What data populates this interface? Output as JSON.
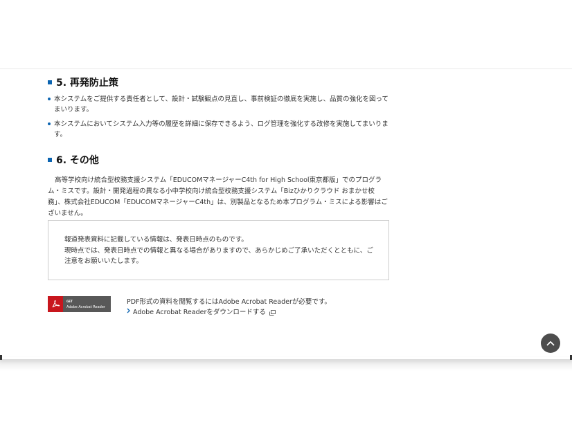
{
  "section5": {
    "heading": "5. 再発防止策",
    "bullets": [
      "本システムをご提供する責任者として、設計・試験観点の見直し、事前検証の徹底を実施し、品質の強化を図ってまいります。",
      "本システムにおいてシステム入力等の履歴を詳細に保存できるよう、ログ管理を強化する改修を実施してまいります。"
    ]
  },
  "section6": {
    "heading": "6. その他",
    "paragraph": "高等学校向け統合型校務支援システム「EDUCOMマネージャーC4th for High School東京都版」でのプログラム・ミスです。設計・開発過程の異なる小中学校向け統合型校務支援システム「Bizひかりクラウド おまかせ校務」、株式会社EDUCOM「EDUCOMマネージャーC4th」は、別製品となるため本プログラム・ミスによる影響はございません。"
  },
  "notice": {
    "line1": "報道発表資料に記載している情報は、発表日時点のものです。",
    "line2": "現時点では、発表日時点での情報と異なる場合がありますので、あらかじめご了承いただくとともに、ご注意をお願いいたします。"
  },
  "acrobat": {
    "badge_get": "GET",
    "badge_name": "Adobe Acrobat Reader",
    "info_text": "PDF形式の資料を閲覧するにはAdobe Acrobat Readerが必要です。",
    "download_link": "Adobe Acrobat Readerをダウンロードする"
  },
  "icons": {
    "bullet": "bullet-dot-icon",
    "heading_marker": "square-marker-icon",
    "chevron": "chevron-right-icon",
    "external": "external-window-icon",
    "scroll_top": "arrow-up-icon",
    "acrobat": "acrobat-logo-icon"
  },
  "colors": {
    "accent": "#0b64b1",
    "acrobat_red": "#c8161d",
    "badge_bg": "#585858",
    "scroll_btn": "#4d4d4d"
  }
}
